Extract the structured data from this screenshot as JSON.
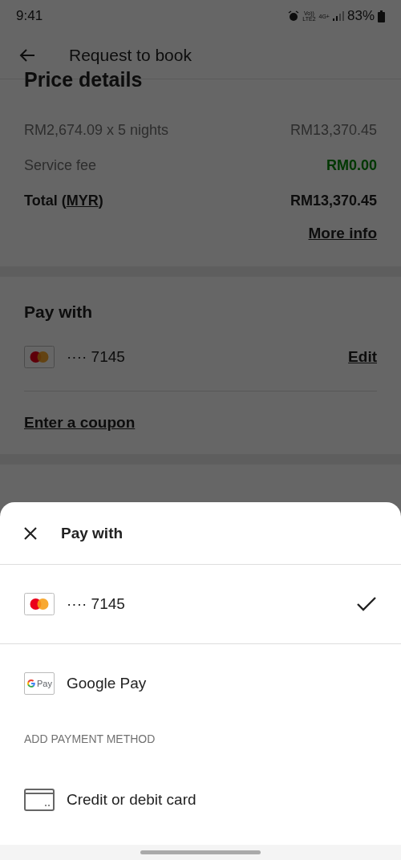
{
  "status_bar": {
    "time": "9:41",
    "volte": "Vo))",
    "lte": "LTE2",
    "network": "4G+",
    "battery": "83%"
  },
  "header": {
    "title": "Request to book"
  },
  "price_details": {
    "title": "Price details",
    "rows": [
      {
        "kind": "normal",
        "label": "RM2,674.09 x 5 nights",
        "amount": "RM13,370.45"
      },
      {
        "kind": "free",
        "label": "Service fee",
        "amount": "RM0.00"
      }
    ],
    "total": {
      "prefix": "Total (",
      "currency": "MYR",
      "suffix": ")",
      "amount": "RM13,370.45"
    },
    "more_info": "More info"
  },
  "pay_with": {
    "title": "Pay with",
    "card": "···· 7145",
    "edit": "Edit",
    "coupon": "Enter a coupon"
  },
  "sheet": {
    "title": "Pay with",
    "methods": [
      {
        "kind": "mastercard",
        "label": "···· 7145",
        "selected": true
      },
      {
        "kind": "gpay",
        "logo_text": "Pay",
        "label": "Google Pay",
        "selected": false
      }
    ],
    "section_label": "ADD PAYMENT METHOD",
    "add_options": [
      {
        "kind": "card",
        "label": "Credit or debit card"
      }
    ]
  }
}
